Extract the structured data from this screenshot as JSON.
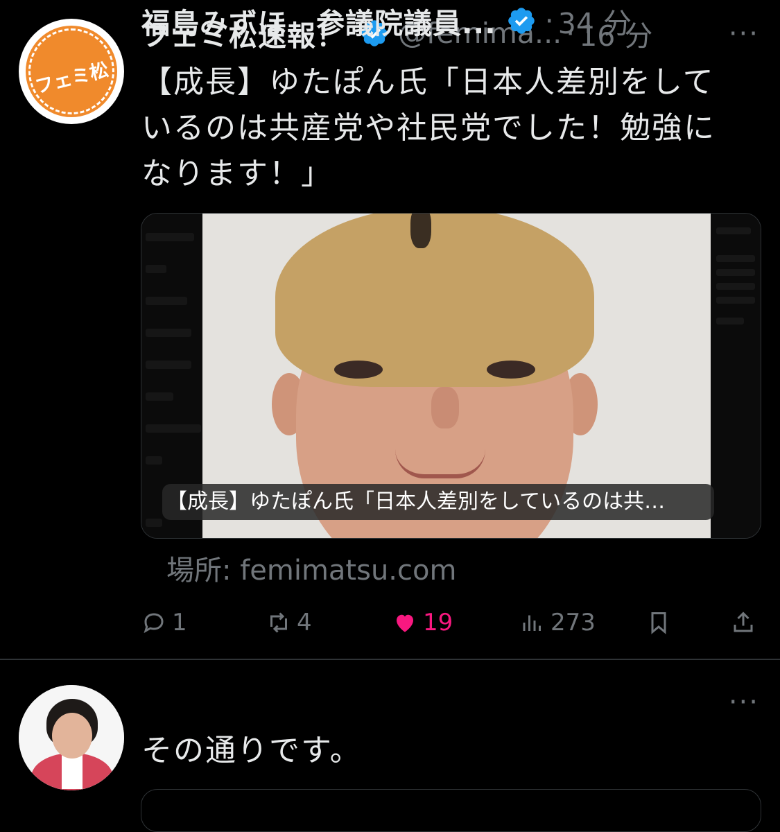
{
  "tweets": [
    {
      "avatar_text": "フェミ松",
      "display_name": "フェミ松速報！",
      "handle": "@femima...",
      "dot": "·",
      "time": "16 分",
      "more": "···",
      "text_lines": [
        "【成長】ゆたぽん氏「日本人差別をして",
        "いるのは共産党や社民党でした！勉強に",
        "なります！」"
      ],
      "media_caption": "【成長】ゆたぽん氏「日本人差別をしているのは共…",
      "source": "場所: femimatsu.com",
      "actions": {
        "reply_count": "1",
        "retweet_count": "4",
        "like_count": "19",
        "views_count": "273"
      },
      "colors": {
        "verified": "#1d9bf0",
        "like": "#f91880",
        "avatar_orange": "#f08a2c"
      }
    },
    {
      "display_name": "福島みずほ　参議院議員...",
      "dot": "·",
      "time": "34 分",
      "more": "···",
      "text_lines": [
        "その通りです。"
      ]
    }
  ]
}
